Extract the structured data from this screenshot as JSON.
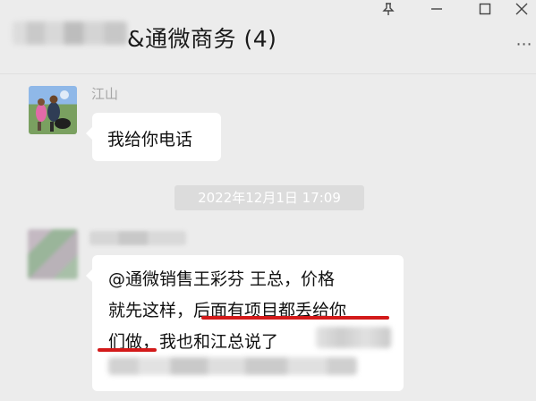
{
  "window": {
    "title": "&通微商务 (4)",
    "pin_icon": "pin-icon",
    "minimize_icon": "minimize-icon",
    "maximize_icon": "maximize-icon",
    "close_icon": "close-icon",
    "more_icon": "more-icon"
  },
  "messages": [
    {
      "sender": "江山",
      "text": "我给你电话"
    },
    {
      "timestamp": "2022年12月1日 17:09"
    },
    {
      "lines": [
        "@通微销售王彩芬 王总，价格",
        "就先这样，后面有项目都丢给你",
        "们做，我也和江总说了"
      ],
      "underlined": [
        "后面有项目都丢给你",
        "们做"
      ],
      "underline_color": "#d31a1a"
    }
  ]
}
